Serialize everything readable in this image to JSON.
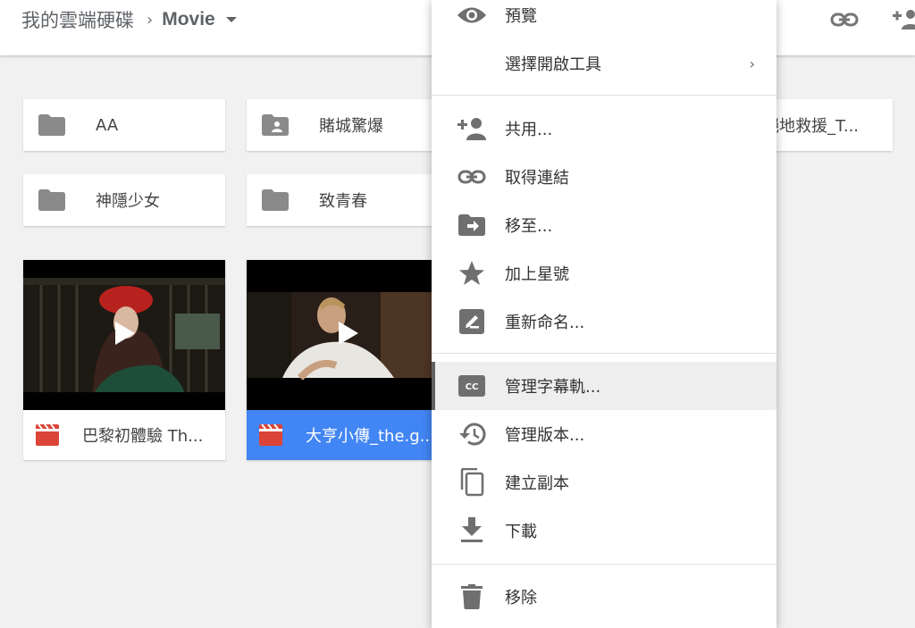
{
  "breadcrumb": {
    "root": "我的雲端硬碟",
    "separator": "›",
    "current": "Movie"
  },
  "top_icons": [
    "link-icon",
    "add-person-icon"
  ],
  "folders": [
    {
      "name": "AA",
      "icon": "folder-icon"
    },
    {
      "name": "賭城驚爆",
      "icon": "shared-folder-icon"
    },
    {
      "name": "絕地救援_T...",
      "icon": "folder-icon"
    },
    {
      "name": "神隱少女",
      "icon": "folder-icon"
    },
    {
      "name": "致青春",
      "icon": "folder-icon"
    }
  ],
  "files": [
    {
      "name": "巴黎初體驗 Th...",
      "icon": "video-file-icon",
      "selected": false
    },
    {
      "name": "大亨小傳_the.g...",
      "icon": "video-file-icon",
      "selected": true
    }
  ],
  "menu": {
    "items": [
      {
        "label": "預覽",
        "icon": "eye-icon"
      },
      {
        "label": "選擇開啟工具",
        "icon": "",
        "submenu": "›"
      },
      {
        "label": "共用...",
        "icon": "add-person-icon"
      },
      {
        "label": "取得連結",
        "icon": "link-icon"
      },
      {
        "label": "移至...",
        "icon": "move-to-folder-icon"
      },
      {
        "label": "加上星號",
        "icon": "star-icon"
      },
      {
        "label": "重新命名...",
        "icon": "rename-icon"
      },
      {
        "label": "管理字幕軌...",
        "icon": "closed-caption-icon",
        "hovered": true
      },
      {
        "label": "管理版本...",
        "icon": "history-icon"
      },
      {
        "label": "建立副本",
        "icon": "copy-icon"
      },
      {
        "label": "下載",
        "icon": "download-icon"
      },
      {
        "label": "移除",
        "icon": "trash-icon"
      }
    ]
  },
  "colors": {
    "selected": "#4285f4",
    "video_icon": "#db4437",
    "icon_gray": "#757575"
  }
}
